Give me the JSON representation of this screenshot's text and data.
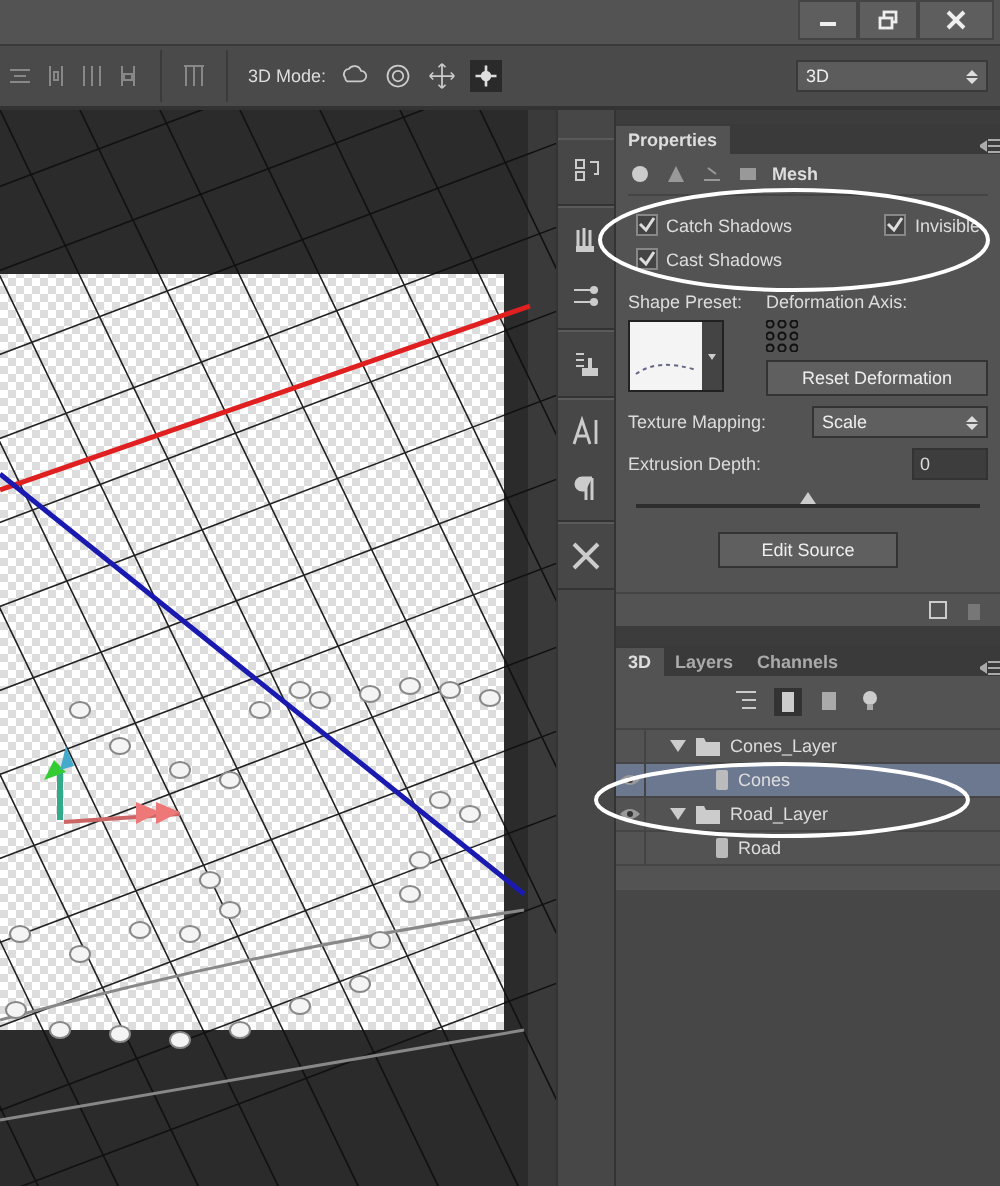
{
  "options_bar": {
    "mode_label": "3D Mode:",
    "mode_buttons": [
      {
        "selected": false
      },
      {
        "selected": false
      },
      {
        "selected": false
      },
      {
        "selected": true
      }
    ],
    "workspace": {
      "value": "3D"
    }
  },
  "properties": {
    "title": "Properties",
    "section_label": "Mesh",
    "checkboxes": [
      {
        "label": "Catch Shadows",
        "checked": true
      },
      {
        "label": "Invisible",
        "checked": true
      },
      {
        "label": "Cast Shadows",
        "checked": true
      }
    ],
    "shape_preset_label": "Shape Preset:",
    "deformation_axis_label": "Deformation Axis:",
    "reset_button": "Reset Deformation",
    "texture_mapping": {
      "label": "Texture Mapping:",
      "value": "Scale"
    },
    "extrusion_depth": {
      "label": "Extrusion Depth:",
      "value": "0",
      "level": 0.5
    },
    "edit_button": "Edit Source"
  },
  "layers_panel": {
    "tabs": [
      {
        "label": "3D",
        "selected": true
      },
      {
        "label": "Layers",
        "selected": false
      },
      {
        "label": "Channels",
        "selected": false
      }
    ],
    "tree": [
      {
        "name": "Cones_Layer",
        "expanded": true,
        "visible": false,
        "selected": false,
        "children": [
          {
            "name": "Cones",
            "visible": true,
            "selected": true
          }
        ]
      },
      {
        "name": "Road_Layer",
        "expanded": true,
        "visible": true,
        "selected": false,
        "children": [
          {
            "name": "Road",
            "visible": false,
            "selected": false
          }
        ]
      }
    ]
  }
}
